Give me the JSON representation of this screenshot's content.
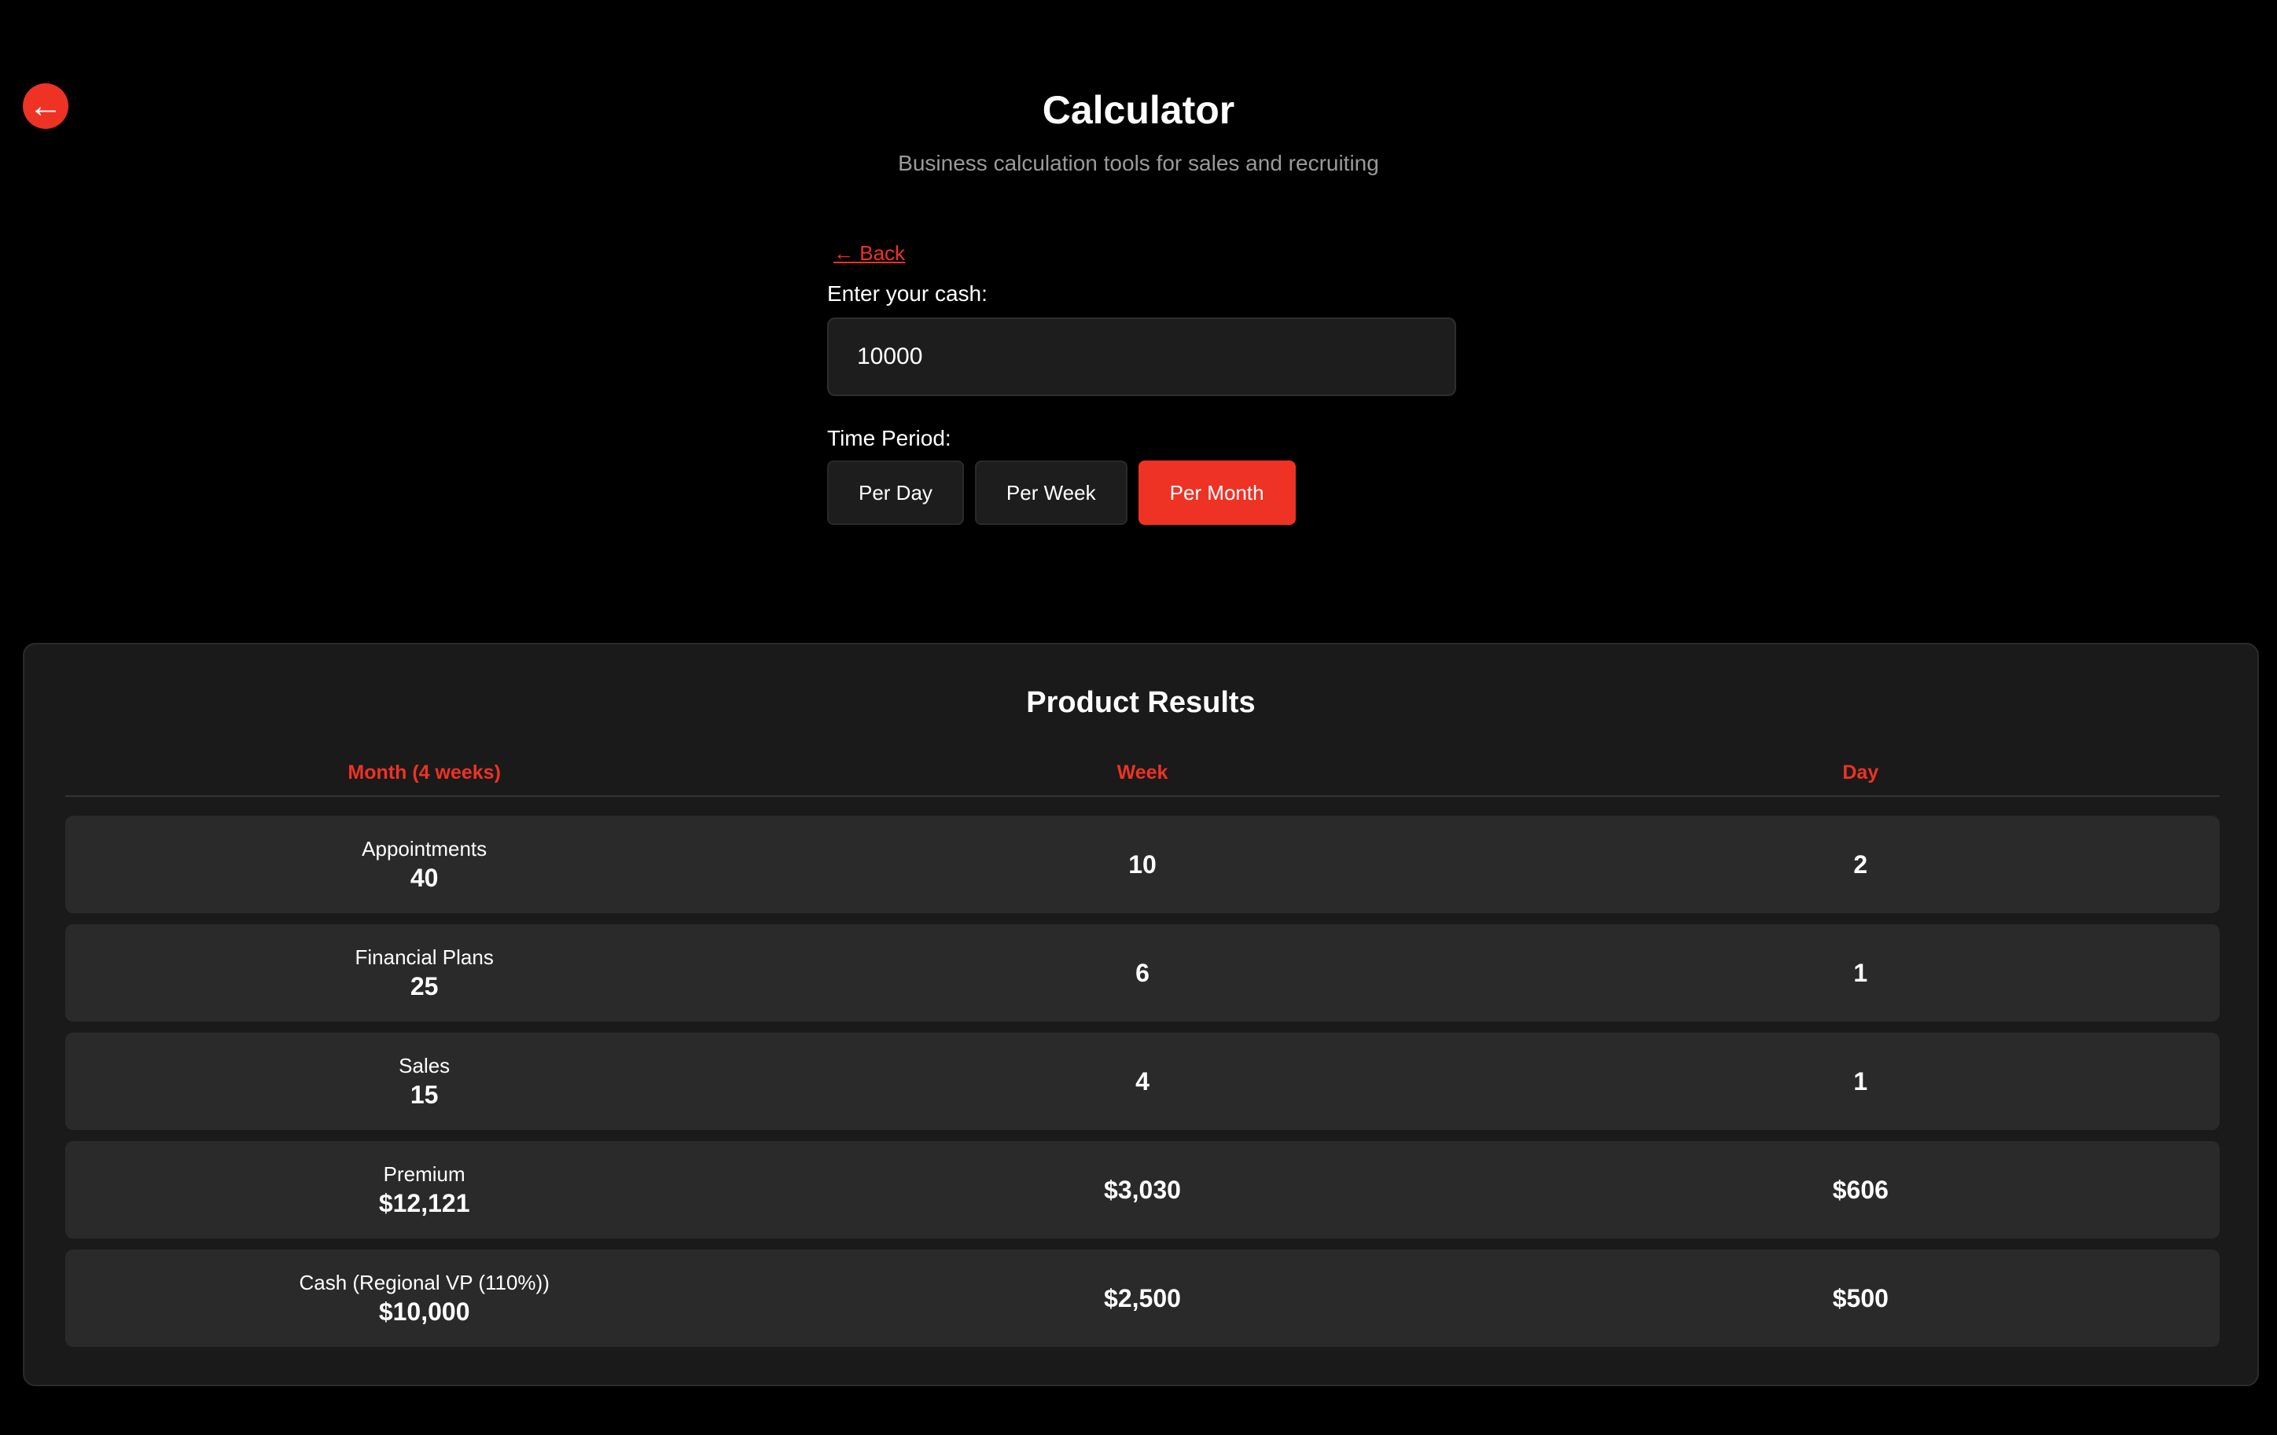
{
  "nav": {
    "back_icon": "←"
  },
  "header": {
    "title": "Calculator",
    "subtitle": "Business calculation tools for sales and recruiting"
  },
  "form": {
    "back_link": "← Back",
    "cash_label": "Enter your cash:",
    "cash_value": "10000",
    "period_label": "Time Period:",
    "period_options": [
      "Per Day",
      "Per Week",
      "Per Month"
    ],
    "selected_period": "Per Month"
  },
  "results": {
    "title": "Product Results",
    "columns": [
      "Month (4 weeks)",
      "Week",
      "Day"
    ],
    "rows": [
      {
        "label": "Appointments",
        "month": "40",
        "week": "10",
        "day": "2"
      },
      {
        "label": "Financial Plans",
        "month": "25",
        "week": "6",
        "day": "1"
      },
      {
        "label": "Sales",
        "month": "15",
        "week": "4",
        "day": "1"
      },
      {
        "label": "Premium",
        "month": "$12,121",
        "week": "$3,030",
        "day": "$606"
      },
      {
        "label": "Cash (Regional VP (110%))",
        "month": "$10,000",
        "week": "$2,500",
        "day": "$500"
      }
    ]
  },
  "colors": {
    "accent": "#ee3224",
    "background": "#000000",
    "panel": "#1a1a1a",
    "row": "#2a2a2a"
  }
}
